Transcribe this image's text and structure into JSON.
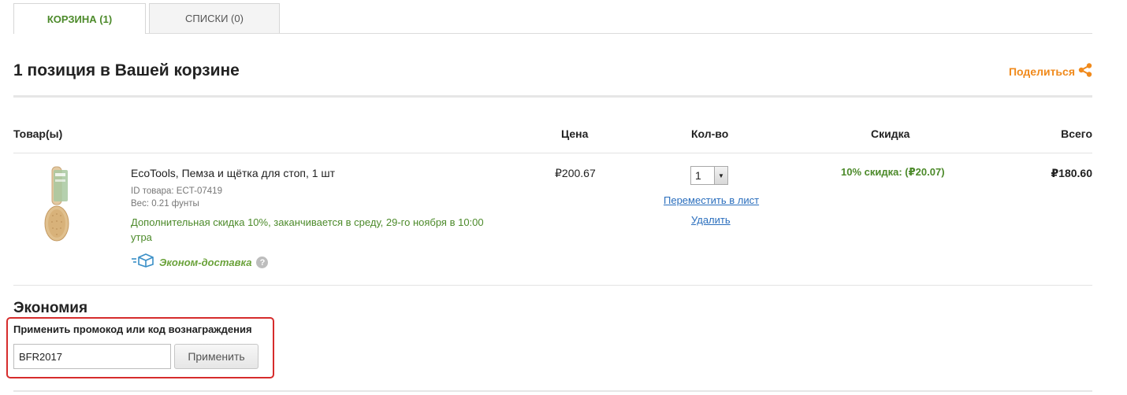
{
  "tabs": [
    {
      "label": "КОРЗИНА (1)"
    },
    {
      "label": "СПИСКИ (0)"
    }
  ],
  "cart": {
    "title": "1 позиция в Вашей корзине",
    "share_label": "Поделиться"
  },
  "table": {
    "headers": {
      "product": "Товар(ы)",
      "price": "Цена",
      "qty": "Кол-во",
      "discount": "Скидка",
      "total": "Всего"
    }
  },
  "item": {
    "name": "EcoTools, Пемза и щётка для стоп, 1 шт",
    "id_text": "ID товара: ECT-07419",
    "weight_text": "Вес: 0.21 фунты",
    "promo_note": "Дополнительная скидка 10%, заканчивается в среду, 29-го ноября в 10:00 утра",
    "shipping_label": "Эконом-доставка",
    "help_icon": "?",
    "price": "₽200.67",
    "qty": "1",
    "move_link": "Переместить в лист",
    "delete_link": "Удалить",
    "discount": "10% скидка: (₽20.07)",
    "total": "₽180.60"
  },
  "savings": {
    "title": "Экономия",
    "promo_label": "Применить промокод или код вознаграждения",
    "promo_value": "BFR2017",
    "apply_label": "Применить"
  },
  "colors": {
    "green": "#4c8a2a",
    "orange": "#f08a1c",
    "link_blue": "#2a6ebd",
    "highlight_red": "#d62c2c"
  },
  "icons": {
    "share": "share-icon",
    "shipping": "box-shipping-icon",
    "help": "help-icon",
    "dropdown": "chevron-down-icon"
  }
}
